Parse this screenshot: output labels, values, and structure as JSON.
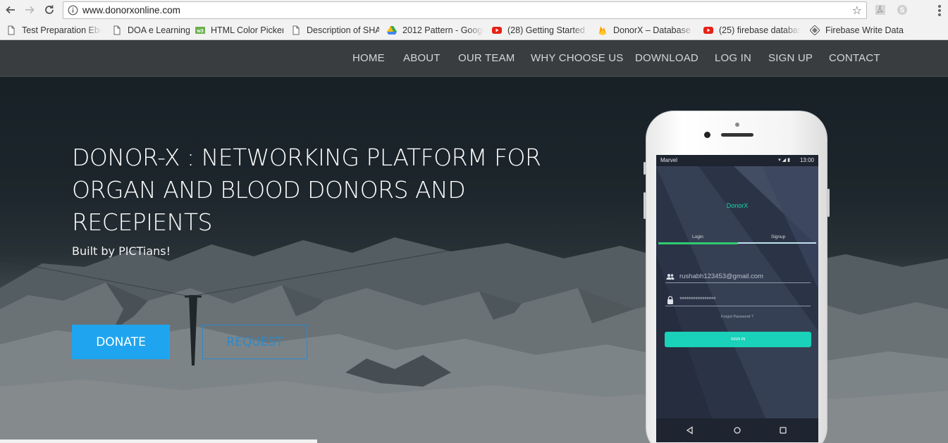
{
  "browser": {
    "url": "www.donorxonline.com",
    "bookmarks": [
      {
        "label": "Test Preparation Ebo",
        "icon": "page-icon"
      },
      {
        "label": "DOA e Learning",
        "icon": "page-icon"
      },
      {
        "label": "HTML Color Picker",
        "icon": "w3-icon"
      },
      {
        "label": "Description of SHA",
        "icon": "page-icon"
      },
      {
        "label": "2012 Pattern - Googl",
        "icon": "drive-icon"
      },
      {
        "label": "(28) Getting Started v",
        "icon": "youtube-icon"
      },
      {
        "label": "DonorX – Database –",
        "icon": "firebase-icon"
      },
      {
        "label": "(25) firebase databas",
        "icon": "youtube-icon"
      },
      {
        "label": "Firebase Write Data",
        "icon": "diamond-icon"
      }
    ]
  },
  "nav": {
    "items": [
      "HOME",
      "ABOUT",
      "OUR TEAM",
      "WHY CHOOSE US",
      "DOWNLOAD",
      "LOG IN",
      "SIGN UP",
      "CONTACT"
    ]
  },
  "hero": {
    "headline": "DONOR-X : NETWORKING PLATFORM FOR ORGAN AND BLOOD DONORS AND RECEPIENTS",
    "subline": "Built by PICTians!",
    "donate_label": "DONATE",
    "request_label": "REQUEST"
  },
  "phone": {
    "carrier": "Marvel",
    "time": "13:00",
    "app_name": "DonorX",
    "tab_login": "Login",
    "tab_signup": "Signup",
    "email_value": "rushabh123453@gmail.com",
    "password_value": "****************",
    "forgot_label": "Forgot Password ?",
    "signin_label": "SIGN IN"
  },
  "colors": {
    "accent_blue": "#1fa5ef",
    "request_blue": "#2c89c9",
    "app_teal": "#1ad1b9",
    "app_green": "#2ecc71"
  }
}
